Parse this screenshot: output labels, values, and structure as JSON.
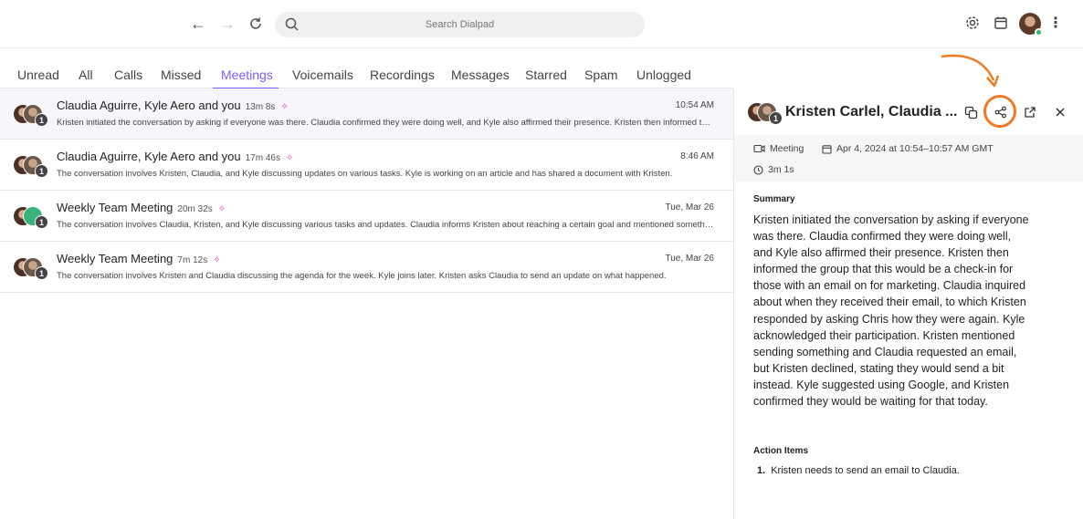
{
  "search": {
    "placeholder": "Search Dialpad"
  },
  "tabs": [
    "Unread",
    "All",
    "Calls",
    "Missed",
    "Meetings",
    "Voicemails",
    "Recordings",
    "Messages",
    "Starred",
    "Spam",
    "Unlogged"
  ],
  "active_tab": "Meetings",
  "accent_color": "#7b5cf0",
  "highlight_color": "#f07a23",
  "conversations": [
    {
      "title": "Claudia Aguirre, Kyle Aero and you",
      "duration": "13m 8s",
      "time": "10:54 AM",
      "badge": "1",
      "summary": "Kristen initiated the conversation by asking if everyone was there. Claudia confirmed they were doing well, and Kyle also affirmed their presence. Kristen then informed the group that this would be a check-in for those with an email on for marketing."
    },
    {
      "title": "Claudia Aguirre, Kyle Aero and you",
      "duration": "17m 46s",
      "time": "8:46 AM",
      "badge": "1",
      "summary": "The conversation involves Kristen, Claudia, and Kyle discussing updates on various tasks. Kyle is working on an article and has shared a document with Kristen."
    },
    {
      "title": "Weekly Team Meeting",
      "duration": "20m 32s",
      "time": "Tue, Mar 26",
      "badge": "1",
      "summary": "The conversation involves Claudia, Kristen, and Kyle discussing various tasks and updates. Claudia informs Kristen about reaching a certain goal and mentioned something else."
    },
    {
      "title": "Weekly Team Meeting",
      "duration": "7m 12s",
      "time": "Tue, Mar 26",
      "badge": "1",
      "summary": "The conversation involves Kristen and Claudia discussing the agenda for the week. Kyle joins later. Kristen asks Claudia to send an update on what happened."
    }
  ],
  "detail": {
    "title": "Kristen Carlel, Claudia ...",
    "badge": "1",
    "type": "Meeting",
    "date": "Apr 4, 2024 at 10:54–10:57 AM GMT",
    "duration": "3m 1s",
    "summary_label": "Summary",
    "summary": "Kristen initiated the conversation by asking if everyone was there. Claudia confirmed they were doing well, and Kyle also affirmed their presence. Kristen then informed the group that this would be a check-in for those with an email on for marketing. Claudia inquired about when they received their email, to which Kristen responded by asking Chris how they were again. Kyle acknowledged their participation. Kristen mentioned sending something and Claudia requested an email, but Kristen declined, stating they would send a bit instead. Kyle suggested using Google, and Kristen confirmed they would be waiting for that today.",
    "action_items_label": "Action Items",
    "action_items": [
      {
        "num": "1.",
        "text": "Kristen needs to send an email to Claudia."
      }
    ]
  }
}
